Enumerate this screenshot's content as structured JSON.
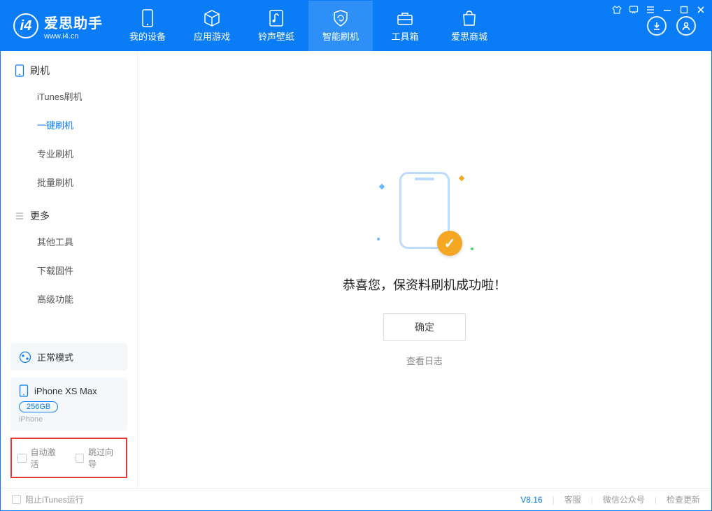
{
  "app": {
    "title": "爱思助手",
    "subtitle": "www.i4.cn"
  },
  "nav": {
    "items": [
      {
        "label": "我的设备"
      },
      {
        "label": "应用游戏"
      },
      {
        "label": "铃声壁纸"
      },
      {
        "label": "智能刷机"
      },
      {
        "label": "工具箱"
      },
      {
        "label": "爱思商城"
      }
    ]
  },
  "sidebar": {
    "section1": "刷机",
    "items1": [
      {
        "label": "iTunes刷机"
      },
      {
        "label": "一键刷机"
      },
      {
        "label": "专业刷机"
      },
      {
        "label": "批量刷机"
      }
    ],
    "section2": "更多",
    "items2": [
      {
        "label": "其他工具"
      },
      {
        "label": "下载固件"
      },
      {
        "label": "高级功能"
      }
    ],
    "mode": "正常模式",
    "device": {
      "name": "iPhone XS Max",
      "capacity": "256GB",
      "type": "iPhone"
    },
    "opts": {
      "auto_activate": "自动激活",
      "skip_guide": "跳过向导"
    }
  },
  "main": {
    "message": "恭喜您，保资料刷机成功啦！",
    "ok": "确定",
    "view_log": "查看日志"
  },
  "footer": {
    "block_itunes": "阻止iTunes运行",
    "version": "V8.16",
    "support": "客服",
    "wechat": "微信公众号",
    "update": "检查更新"
  }
}
